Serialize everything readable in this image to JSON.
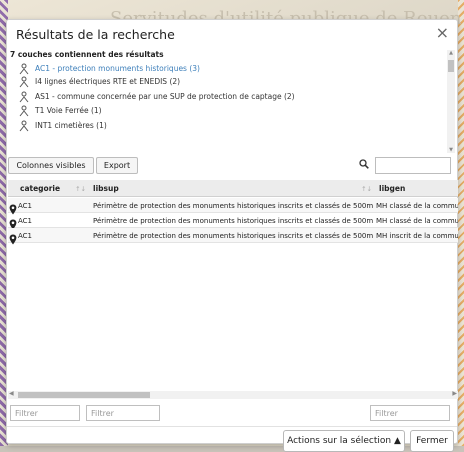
{
  "map": {
    "background_title": "Servitudes d'utilité publique de Rouen"
  },
  "dialog": {
    "title": "Résultats de la recherche",
    "close_glyph": "×"
  },
  "summary": {
    "title": "7 couches contiennent des résultats",
    "items": [
      {
        "label": "AC1 - protection monuments historiques (3)",
        "active": true
      },
      {
        "label": "I4 lignes électriques RTE et ENEDIS (2)"
      },
      {
        "label": "AS1 - commune concernée par une SUP de protection de captage (2)"
      },
      {
        "label": "T1 Voie Ferrée (1)"
      },
      {
        "label": "INT1 cimetières (1)"
      }
    ]
  },
  "toolbar": {
    "columns_button": "Colonnes visibles",
    "export_button": "Export",
    "search_icon": "search-icon",
    "search_value": ""
  },
  "table": {
    "columns": [
      {
        "label": "categorie",
        "sort": "↑↓"
      },
      {
        "label": "libsup",
        "sort": "↑↓"
      },
      {
        "label": "libgen",
        "sort": ""
      }
    ],
    "rows": [
      {
        "categorie": "AC1",
        "libsup": "Périmètre de protection des monuments historiques inscrits et classés de 500m",
        "libgen": "MH classé de la commune"
      },
      {
        "categorie": "AC1",
        "libsup": "Périmètre de protection des monuments historiques inscrits et classés de 500m",
        "libgen": "MH classé de la commune"
      },
      {
        "categorie": "AC1",
        "libsup": "Périmètre de protection des monuments historiques inscrits et classés de 500m",
        "libgen": "MH inscrit de la commune"
      }
    ]
  },
  "filters": {
    "placeholder1": "Filtrer",
    "placeholder2": "Filtrer",
    "placeholder3": "Filtrer"
  },
  "footer": {
    "actions_button": "Actions sur la sélection ▲",
    "close_button": "Fermer"
  },
  "colors": {
    "accent": "#3d7fba",
    "header_bg": "#ececec"
  }
}
